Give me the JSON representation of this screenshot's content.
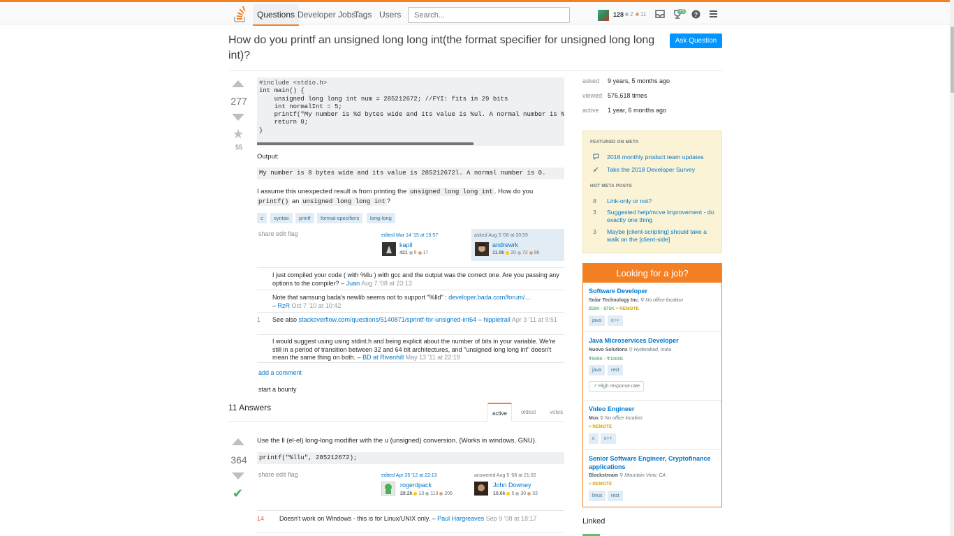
{
  "nav": {
    "questions": "Questions",
    "jobs": "Developer Jobs",
    "tags": "Tags",
    "users": "Users",
    "search_placeholder": "Search...",
    "rep": "128",
    "silver": "2",
    "bronze": "11",
    "achievements_badge": "+5"
  },
  "question": {
    "title": "How do you printf an unsigned long long int(the format specifier for unsigned long long int)?",
    "ask_button": "Ask Question",
    "votes": "277",
    "favorites": "55",
    "code_lines": [
      "#include <stdio.h>",
      "int main() {",
      "    unsigned long long int num = 285212672; //FYI: fits in 29 bits",
      "    int normalInt = 5;",
      "    printf(\"My number is %d bytes wide and its value is %ul. A normal number is %d.\\n\",",
      "    return 0;",
      "}"
    ],
    "output_label": "Output:",
    "output_code": "My number is 8 bytes wide and its value is 285212672l. A normal number is 0.",
    "text_1": "I assume this unexpected result is from printing the",
    "text_code_1": "unsigned long long int",
    "text_2": ". How do you",
    "text_code_2": "printf()",
    "text_3": "an",
    "text_code_3": "unsigned long long int",
    "text_4": "?",
    "tags": [
      "c",
      "syntax",
      "printf",
      "format-specifiers",
      "long-long"
    ],
    "menu": {
      "share": "share",
      "edit": "edit",
      "flag": "flag"
    },
    "editor": {
      "action": "edited Mar 14 '15 at 15:57",
      "name": "kapil",
      "rep": "421",
      "silver": "5",
      "bronze": "17"
    },
    "owner": {
      "action": "asked Aug 5 '08 at 20:59",
      "name": "andrewrk",
      "rep": "11.9k",
      "gold": "20",
      "silver": "72",
      "bronze": "96"
    },
    "comments": [
      {
        "score": "",
        "text": "I just compiled your code ( with %llu ) with gcc and the output was the correct one. Are you passing any options to the compiler? – ",
        "user": "Juan",
        "date": "Aug 7 '08 at 23:13"
      },
      {
        "score": "",
        "text": "Note that samsung bada's newlib seems not to support \"%lld\" : ",
        "link": "developer.bada.com/forum/…",
        "text2": " – ",
        "user": "RzR",
        "date": "Oct 7 '10 at 10:42"
      },
      {
        "score": "1",
        "text": "See also ",
        "link": "stackoverflow.com/questions/5140871/sprintf-for-unsigned-int64",
        "text2": " – ",
        "user": "hippietrail",
        "date": "Apr 3 '11 at 9:51"
      },
      {
        "score": "",
        "text": "I would suggest using using stdint.h and being explicit about the number of bits in your variable. We're still in a period of transition between 32 and 64 bit architectures, and \"unsigned long long int\" doesn't mean the same thing on both. – ",
        "user": "BD at Rivenhill",
        "date": "May 13 '11 at 22:19"
      }
    ],
    "add_comment": "add a comment",
    "bounty": "start a bounty"
  },
  "answers": {
    "count_label": "11 Answers",
    "tabs": [
      "active",
      "oldest",
      "votes"
    ],
    "first": {
      "votes": "364",
      "text": "Use the ll (el-el) long-long modifier with the u (unsigned) conversion. (Works in windows, GNU).",
      "code": "printf(\"%llu\", 285212672);",
      "menu": {
        "share": "share",
        "edit": "edit",
        "flag": "flag"
      },
      "editor": {
        "action": "edited Apr 25 '12 at 22:13",
        "name": "rogerdpack",
        "rep": "28.2k",
        "gold": "13",
        "silver": "113",
        "bronze": "205"
      },
      "owner": {
        "action": "answered Aug 5 '08 at 21:02",
        "name": "John Downey",
        "rep": "10.6k",
        "gold": "5",
        "silver": "30",
        "bronze": "33"
      },
      "comment": {
        "score": "14",
        "text": "Doesn't work on Windows - this is for Linux/UNIX only. – ",
        "user": "Paul Hargreaves",
        "date": "Sep 9 '08 at 18:17"
      }
    }
  },
  "sidebar": {
    "asked_label": "asked",
    "asked_val": "9 years, 5 months ago",
    "viewed_label": "viewed",
    "viewed_val": "576,618 times",
    "active_label": "active",
    "active_val": "1 year, 6 months ago",
    "featured_head": "FEATURED ON META",
    "featured": [
      "2018 monthly product team updates",
      "Take the 2018 Developer Survey"
    ],
    "hot_head": "HOT META POSTS",
    "hot": [
      {
        "num": "8",
        "title": "Link-only or not?"
      },
      {
        "num": "3",
        "title": "Suggested help/mcve improvement - do exactly one thing"
      },
      {
        "num": "3",
        "title": "Maybe [client-scripting] should take a walk on the [client-side]"
      }
    ],
    "jobs_head": "Looking for a job?",
    "jobs": [
      {
        "title": "Software Developer",
        "company": "Solar Technology Inc.",
        "location": "No office location",
        "salary": "$50K - $75K",
        "remote": "REMOTE",
        "tags": [
          "java",
          "c++"
        ]
      },
      {
        "title": "Java Microservices Developer",
        "company": "Nuovo Solutions",
        "location": "Hyderabad, India",
        "salary": "₹500K - ₹1000K",
        "remote": "",
        "tags": [
          "java",
          "rest"
        ],
        "badge": "High response rate"
      },
      {
        "title": "Video Engineer",
        "company": "Mux",
        "location": "No office location",
        "salary": "",
        "remote": "REMOTE",
        "tags": [
          "c",
          "c++"
        ]
      },
      {
        "title": "Senior Software Engineer, Cryptofinance applications",
        "company": "Blockstream",
        "location": "Mountain View, CA",
        "salary": "",
        "remote": "REMOTE",
        "tags": [
          "linux",
          "rest"
        ]
      }
    ],
    "linked": "Linked"
  }
}
